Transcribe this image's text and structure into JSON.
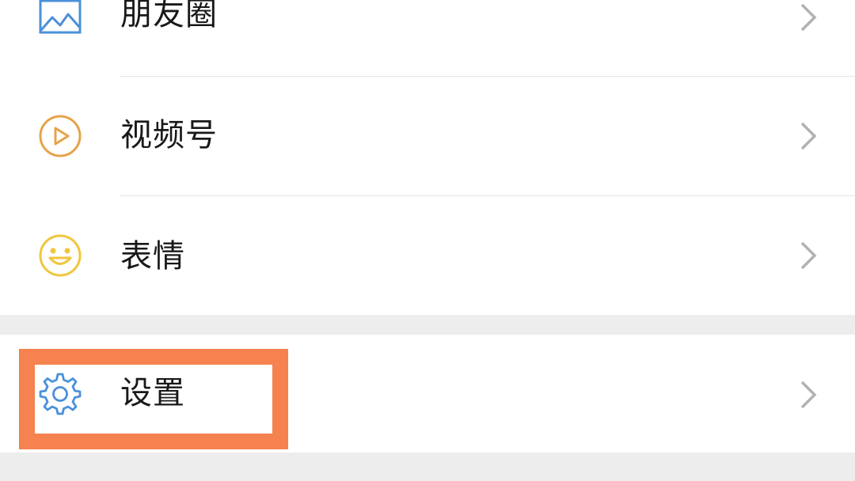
{
  "menu": {
    "items": [
      {
        "label": "朋友圈",
        "icon": "moments-icon",
        "icon_color": "#4a90d9"
      },
      {
        "label": "视频号",
        "icon": "channels-icon",
        "icon_color": "#e6a34a"
      },
      {
        "label": "表情",
        "icon": "sticker-icon",
        "icon_color": "#f0c63c"
      }
    ],
    "settings": {
      "label": "设置",
      "icon": "gear-icon",
      "icon_color": "#4a90d9"
    }
  },
  "highlight": {
    "color": "#f5824f",
    "target": "设置"
  },
  "colors": {
    "background": "#ededed",
    "card": "#ffffff",
    "divider": "#e4e4e4",
    "chevron": "#b2b2b2",
    "text": "#191919"
  }
}
